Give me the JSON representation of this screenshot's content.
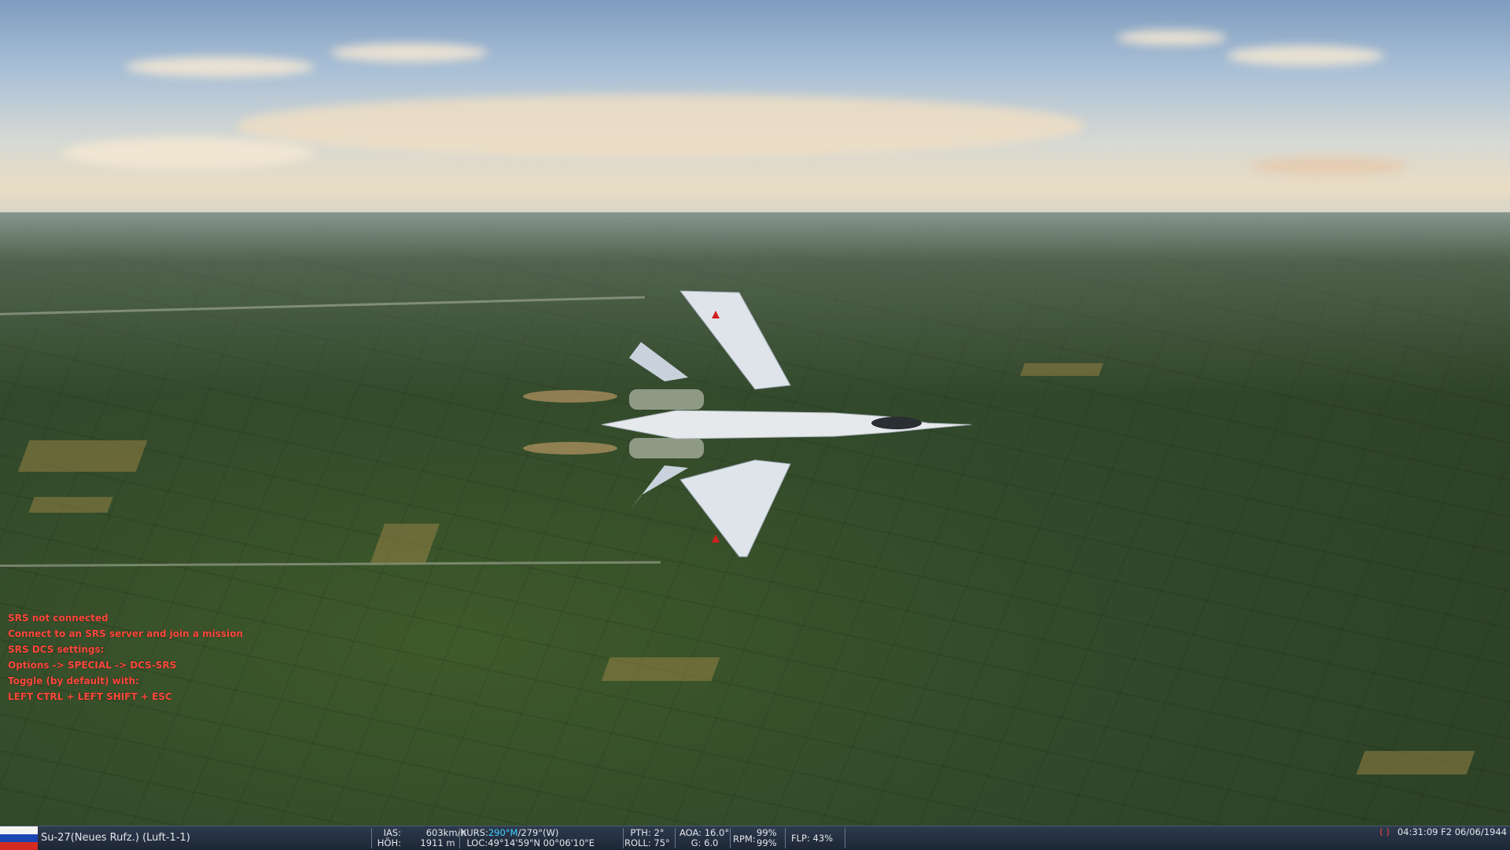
{
  "hud_messages": [
    "SRS not connected",
    "Connect to an SRS server and join a mission",
    "SRS DCS settings:",
    "Options -> SPECIAL -> DCS-SRS",
    "Toggle (by default) with:",
    "LEFT CTRL + LEFT SHIFT + ESC"
  ],
  "status": {
    "flag": "russian-flag-icon",
    "unit": "Su-27(Neues Rufz.) (Luft-1-1)",
    "ias_label": "IAS:",
    "ias_value": "603",
    "ias_unit": "km/h",
    "alt_label": "HÖH:",
    "alt_value": "1911",
    "alt_unit": "m",
    "crs_label": "KURS:",
    "crs_mag": "290°M",
    "crs_true": "/279°(W)",
    "loc_label": "LOC:",
    "loc_value": "49°14'59\"N 00°06'10\"E",
    "pth_label": "PTH:",
    "pth_value": "2°",
    "roll_label": "ROLL:",
    "roll_value": "75°",
    "aoa_label": "AOA:",
    "aoa_value": "16.0°",
    "g_label": "G:",
    "g_value": "6.0",
    "rpm_label": "RPM:",
    "rpm_1": "99%",
    "rpm_2": "99%",
    "flp_label": "FLP:",
    "flp_value": "43%",
    "time_paren": "( )",
    "time": "04:31:09",
    "date": "F2 06/06/1944"
  },
  "colors": {
    "hud_text": "#ff4a3d",
    "heading_highlight": "#3fd0ff",
    "statusbar": "#253044"
  }
}
